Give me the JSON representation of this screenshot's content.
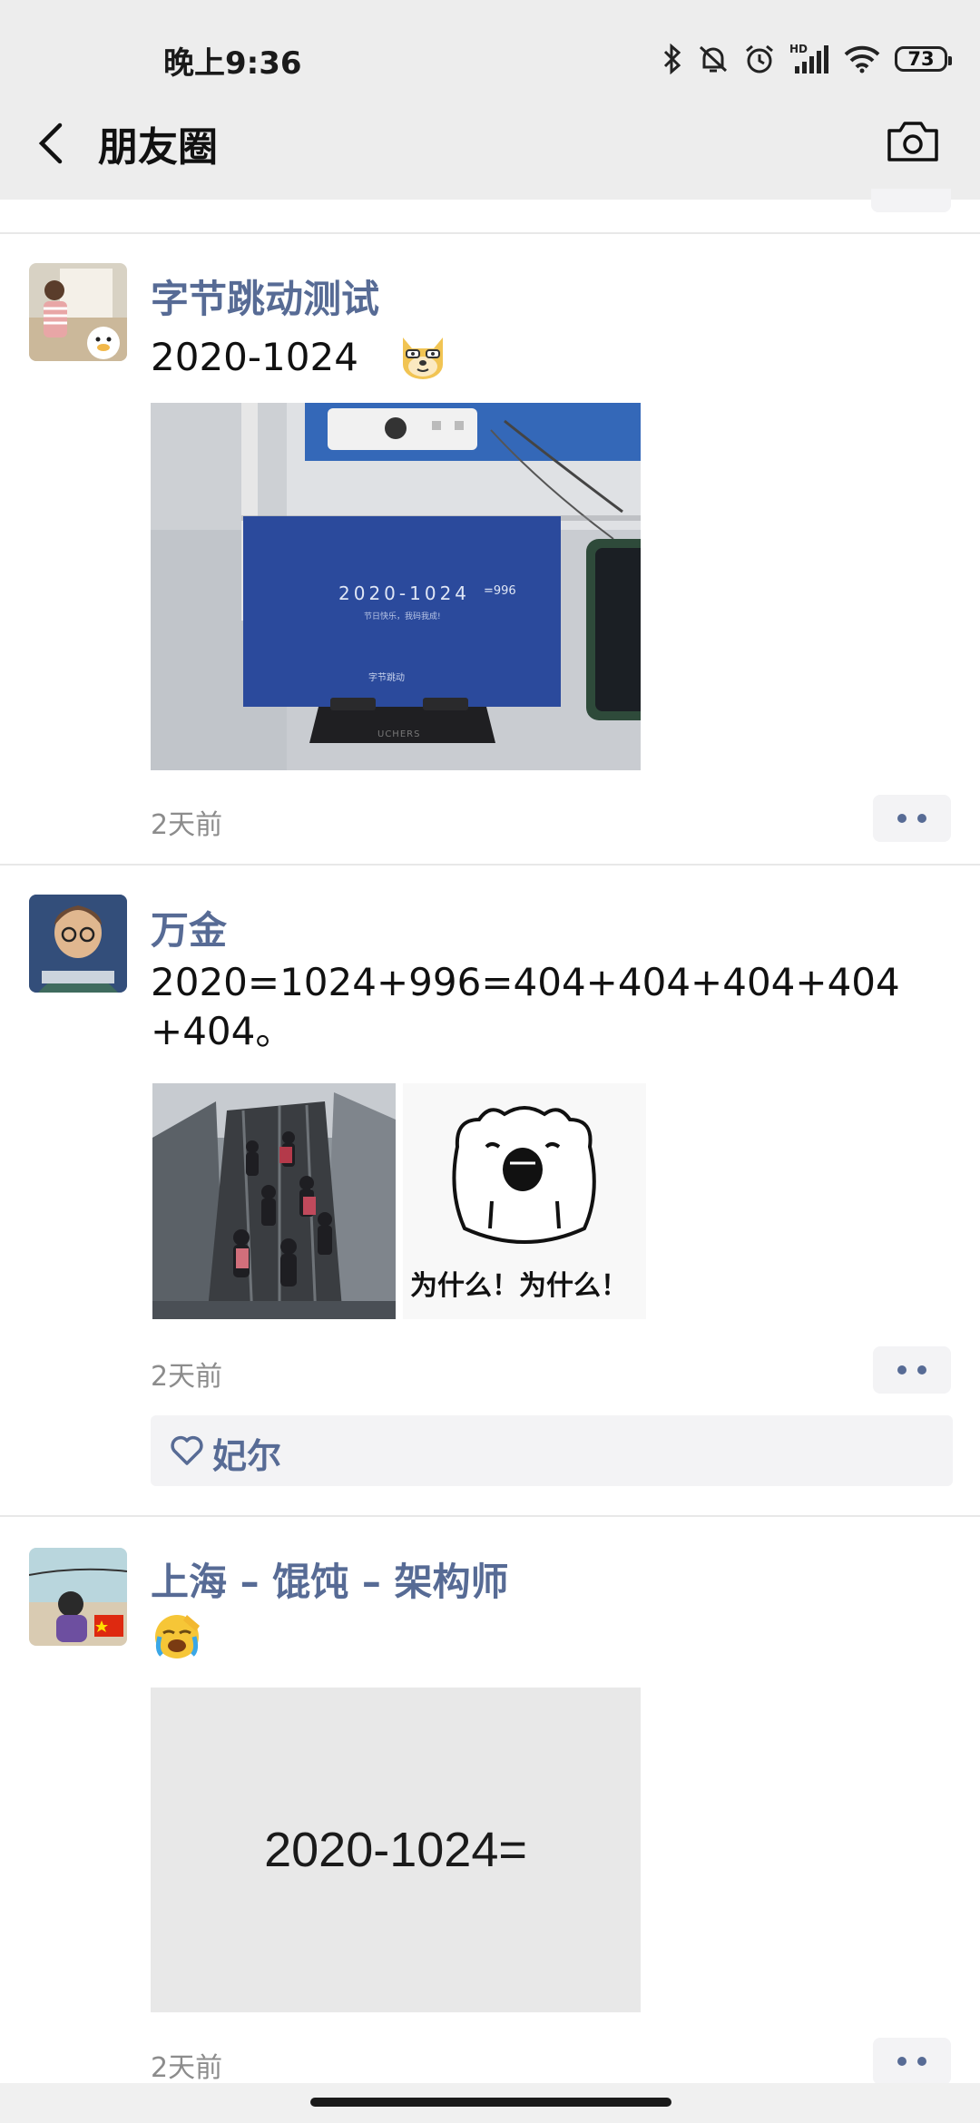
{
  "status": {
    "time": "晚上9:36",
    "battery": "73"
  },
  "nav": {
    "title": "朋友圈"
  },
  "posts": [
    {
      "name": "字节跳动测试",
      "text": "2020-1024",
      "time": "2天前",
      "card": {
        "headline": "2020-1024",
        "suffix": "=996",
        "subtitle": "节日快乐，我码我成!",
        "brand": "字节跳动",
        "stand": "UCHERS"
      }
    },
    {
      "name": "万金",
      "text": "2020=1024+996=404+404+404+404+404。",
      "time": "2天前",
      "meme_caption": "为什么！为什么！",
      "likes": "妃尔"
    },
    {
      "name": "上海 – 馄饨 – 架构师",
      "time": "2天前",
      "image_text": "2020-1024="
    }
  ],
  "colors": {
    "link": "#576b95",
    "bar": "#ededed",
    "card": "#2b4a9c"
  }
}
